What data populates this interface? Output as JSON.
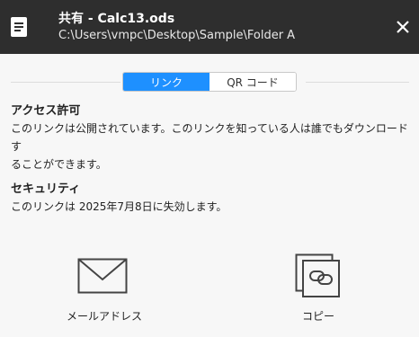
{
  "titlebar": {
    "app_icon": "document-icon",
    "title": "共有 - Calc13.ods",
    "path": "C:\\Users\\vmpc\\Desktop\\Sample\\Folder A",
    "close_icon": "close-icon"
  },
  "tabs": [
    {
      "label": "リンク",
      "active": true
    },
    {
      "label": "QR コード",
      "active": false
    }
  ],
  "access": {
    "heading": "アクセス許可",
    "line1": "このリンクは公開されています。このリンクを知っている人は誰でもダウンロードす",
    "line2": "ることができます。"
  },
  "security": {
    "heading": "セキュリティ",
    "text": "このリンクは 2025年7月8日に失効します。"
  },
  "actions": {
    "email": {
      "label": "メールアドレス",
      "icon": "envelope-icon"
    },
    "copy": {
      "label": "コピー",
      "icon": "copy-link-icon"
    }
  },
  "colors": {
    "titlebar_bg": "#2e2e2e",
    "accent": "#1e90ff",
    "background": "#f7f7f7"
  }
}
